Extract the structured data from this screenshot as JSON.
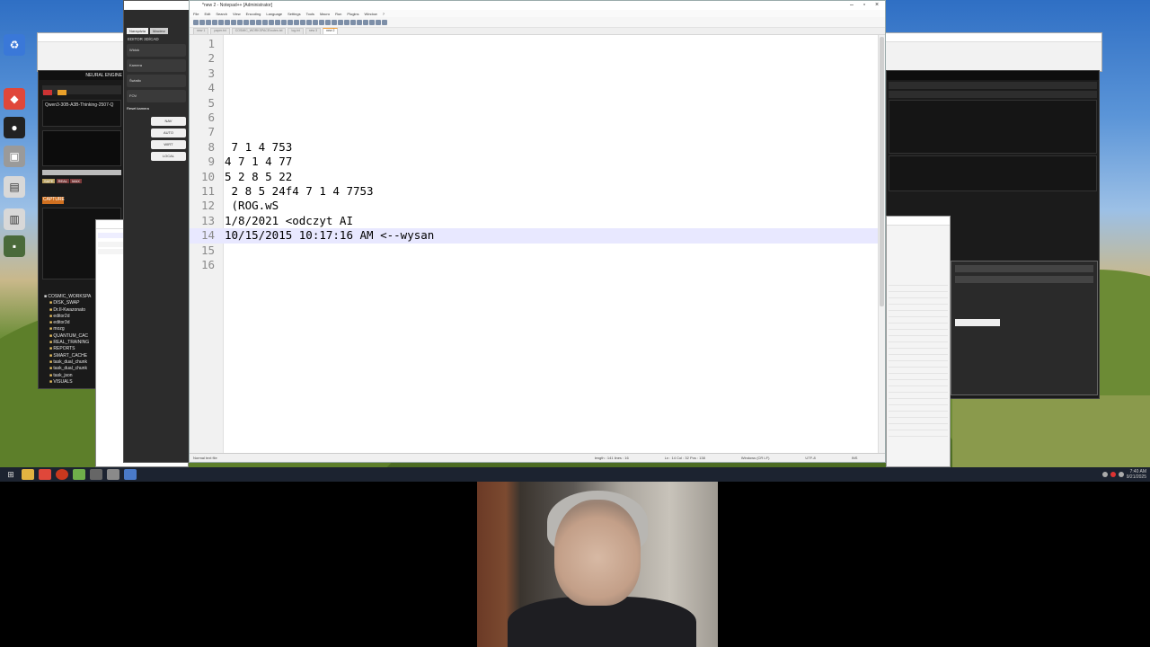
{
  "notepad": {
    "title": "*new 2 - Notepad++ [Administrator]",
    "menu": [
      "File",
      "Edit",
      "Search",
      "View",
      "Encoding",
      "Language",
      "Settings",
      "Tools",
      "Macro",
      "Run",
      "Plugins",
      "Window",
      "?"
    ],
    "tabs": [
      {
        "label": "new 1",
        "active": false
      },
      {
        "label": "paper.txt",
        "active": false
      },
      {
        "label": "COSMIC_WORKSPACE\\notes.txt",
        "active": false
      },
      {
        "label": "log.txt",
        "active": false
      },
      {
        "label": "new 3",
        "active": false
      },
      {
        "label": "new 2",
        "active": true
      }
    ],
    "lines": [
      {
        "n": "1",
        "text": ""
      },
      {
        "n": "2",
        "text": ""
      },
      {
        "n": "3",
        "text": ""
      },
      {
        "n": "4",
        "text": ""
      },
      {
        "n": "5",
        "text": ""
      },
      {
        "n": "6",
        "text": ""
      },
      {
        "n": "7",
        "text": ""
      },
      {
        "n": "8",
        "text": " 7 1 4 753"
      },
      {
        "n": "9",
        "text": "4 7 1 4 77"
      },
      {
        "n": "10",
        "text": "5 2 8 5 22"
      },
      {
        "n": "11",
        "text": " 2 8 5 24f4 7 1 4 7753"
      },
      {
        "n": "12",
        "text": " (ROG.wS"
      },
      {
        "n": "13",
        "text": "1/8/2021 <odczyt AI"
      },
      {
        "n": "14",
        "text": "10/15/2015 10:17:16 AM <--wysan"
      },
      {
        "n": "15",
        "text": ""
      },
      {
        "n": "16",
        "text": ""
      }
    ],
    "current_line": 14,
    "status": {
      "type": "Normal text file",
      "length": "length : 141   lines : 16",
      "position": "Ln : 14   Col : 32   Pos : 138",
      "eol": "Windows (CR LF)",
      "encoding": "UTF-8",
      "mode": "INS"
    }
  },
  "left_panel": {
    "title": "EDITOR 3D/CAD",
    "tab1": "Narzędzia",
    "tab2": "Macierz",
    "rows": [
      "Widok",
      "Kamera",
      "Światło",
      "FOV"
    ],
    "buttons": [
      "3D",
      "NAV",
      "AUTO",
      "WIRT",
      "LOCAL"
    ],
    "reset": "Reset kamera"
  },
  "neural": {
    "header": "NEURAL ENGINE",
    "model": "Qwen3-30B-A3B-Thinking-2507-Q",
    "capture": "CAPTURE",
    "tree": [
      "COSMIC_WORKSPA",
      "DISK_SWAP",
      "Dr.II-Kwazonato",
      "editor2d",
      "editor3d",
      "mozg",
      "QUANTUM_CAC",
      "REAL_TRAINING",
      "REPORTS",
      "SMART_CACHE",
      "task_dual_chunk",
      "task_dual_chunk",
      "task_json",
      "VISUALS"
    ]
  },
  "taskbar": {
    "time": "7:40 AM",
    "date": "9/21/2025"
  },
  "colors": {
    "accent": "#f29a2e",
    "current_line": "#e8e8ff",
    "gutter": "#f1f1f1"
  }
}
